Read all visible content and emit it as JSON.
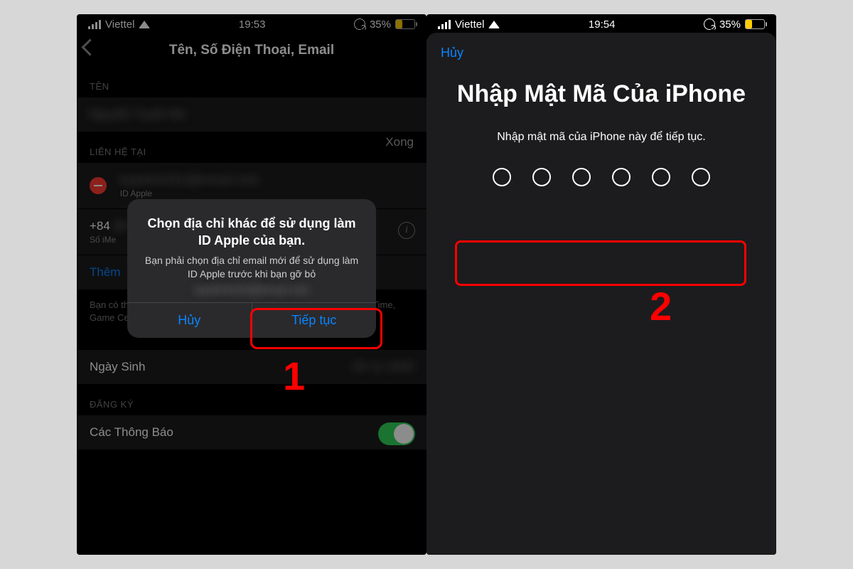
{
  "annotations": {
    "step1": "1",
    "step2": "2"
  },
  "left": {
    "status": {
      "carrier": "Viettel",
      "time": "19:53",
      "battery": "35%"
    },
    "nav": {
      "title": "Tên, Số Điện Thoại, Email"
    },
    "sections": {
      "ten_header": "TÊN",
      "ten_value": "Nguyễn Tuyết Nhi",
      "lienhe_header": "LIÊN HỆ TẠI",
      "xong": "Xong",
      "email_sublabel": "ID Apple",
      "phone_prefix": "+84",
      "phone_sublabel": "Số iMe",
      "add_link": "Thêm",
      "footer_text": "Bạn có thể nhận liên hệ qua email này đến ID Apple, iMessage, FaceTime, Game Center và nhiều ứng dụng khác.",
      "birthday_label": "Ngày Sinh",
      "dangky_header": "ĐĂNG KÝ",
      "notifications_label": "Các Thông Báo"
    },
    "alert": {
      "title": "Chọn địa chỉ khác để sử dụng làm ID Apple của bạn.",
      "message": "Bạn phải chọn địa chỉ email mới để sử dụng làm ID Apple trước khi bạn gỡ bỏ",
      "cancel": "Hủy",
      "continue": "Tiếp tục"
    }
  },
  "right": {
    "status": {
      "carrier": "Viettel",
      "time": "19:54",
      "battery": "35%"
    },
    "sheet": {
      "cancel": "Hủy",
      "title": "Nhập Mật Mã Của iPhone",
      "prompt": "Nhập mật mã của iPhone này để tiếp tục.",
      "digits": 6
    }
  }
}
